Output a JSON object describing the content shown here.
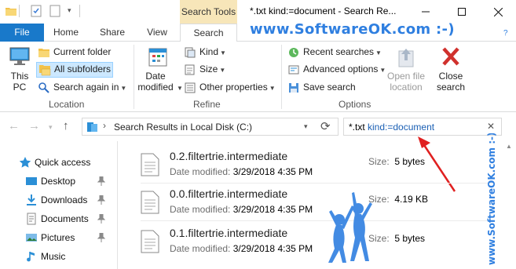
{
  "window": {
    "title": "*.txt kind:=document - Search Re...",
    "contextual_tab_header": "Search Tools"
  },
  "tabs": [
    "File",
    "Home",
    "Share",
    "View",
    "Search"
  ],
  "watermark": "www.SoftwareOK.com :-)",
  "side_watermark": "www.SoftwareOK.com :-)",
  "ribbon": {
    "location": {
      "group_label": "Location",
      "this_pc": "This PC",
      "current_folder": "Current folder",
      "all_subfolders": "All subfolders",
      "search_again_in": "Search again in"
    },
    "refine": {
      "group_label": "Refine",
      "date_modified": "Date modified",
      "kind": "Kind",
      "size": "Size",
      "other_properties": "Other properties"
    },
    "options": {
      "group_label": "Options",
      "recent_searches": "Recent searches",
      "advanced_options": "Advanced options",
      "save_search": "Save search",
      "open_file_location": "Open file location",
      "close_search": "Close search"
    }
  },
  "address": {
    "path": "Search Results in Local Disk (C:)"
  },
  "search": {
    "query_prefix": "*.txt",
    "query_kind": "kind:=document"
  },
  "nav": {
    "items": [
      "Quick access",
      "Desktop",
      "Downloads",
      "Documents",
      "Pictures",
      "Music"
    ]
  },
  "results": [
    {
      "name": "0.2.filtertrie.intermediate",
      "date_label": "Date modified:",
      "date": "3/29/2018 4:35 PM",
      "size_label": "Size:",
      "size": "5 bytes"
    },
    {
      "name": "0.0.filtertrie.intermediate",
      "date_label": "Date modified:",
      "date": "3/29/2018 4:35 PM",
      "size_label": "Size:",
      "size": "4.19 KB"
    },
    {
      "name": "0.1.filtertrie.intermediate",
      "date_label": "Date modified:",
      "date": "3/29/2018 4:35 PM",
      "size_label": "Size:",
      "size": "5 bytes"
    }
  ],
  "colors": {
    "accent": "#1979ca",
    "contextual_tab": "#f7e6b9",
    "watermark": "#2f7fe0",
    "arrow": "#e02020"
  }
}
